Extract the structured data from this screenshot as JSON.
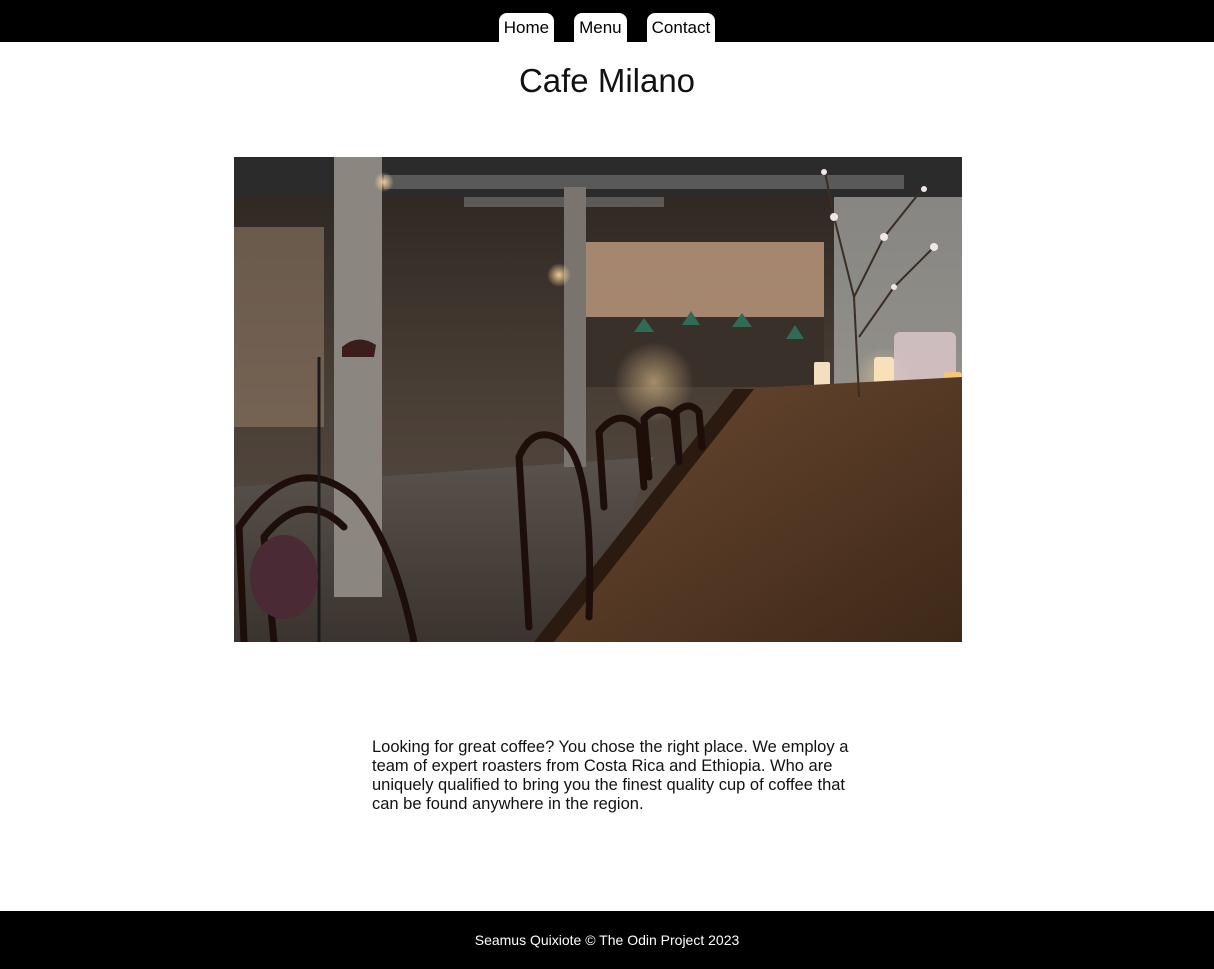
{
  "nav": {
    "tabs": [
      {
        "label": "Home"
      },
      {
        "label": "Menu"
      },
      {
        "label": "Contact"
      }
    ]
  },
  "page": {
    "title": "Cafe Milano"
  },
  "hero": {
    "icon": "cafe-interior-photo"
  },
  "content": {
    "paragraph": "Looking for great coffee? You chose the right place. We employ a team of expert roasters from Costa Rica and Ethiopia. Who are uniquely qualified to bring you the finest quality cup of coffee that can be found anywhere in the region."
  },
  "footer": {
    "credit": "Seamus Quixiote © The Odin Project 2023"
  },
  "colors": {
    "bar": "#000000",
    "background": "#ffffff",
    "text": "#111111"
  }
}
